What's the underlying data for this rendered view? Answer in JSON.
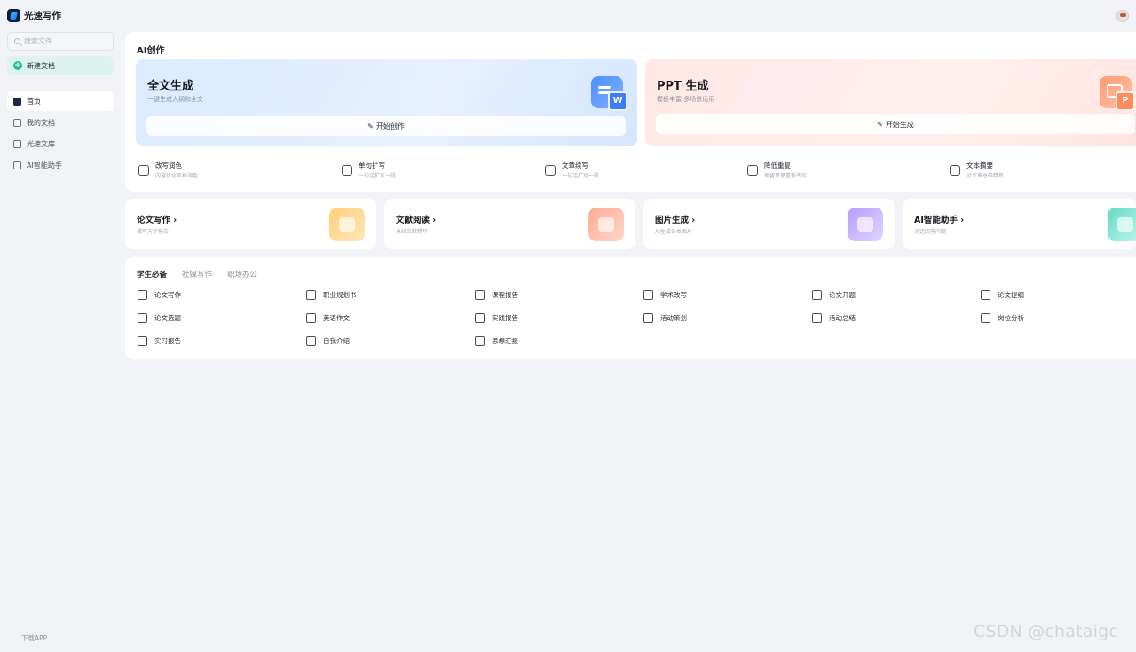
{
  "app": {
    "name": "光速写作"
  },
  "sidebar": {
    "search_placeholder": "搜索文件",
    "new_doc": "新建文档",
    "items": [
      {
        "label": "首页",
        "active": true,
        "icon": "home-icon"
      },
      {
        "label": "我的文档",
        "active": false,
        "icon": "document-icon"
      },
      {
        "label": "光速文库",
        "active": false,
        "icon": "library-icon"
      },
      {
        "label": "AI智能助手",
        "active": false,
        "icon": "chat-icon"
      }
    ],
    "download": "下载APP"
  },
  "ai_section": {
    "title": "AI创作",
    "full_text": {
      "title": "全文生成",
      "subtitle": "一键生成大纲和全文",
      "button": "开始创作"
    },
    "ppt": {
      "title": "PPT 生成",
      "subtitle": "模板丰富 多场景适用",
      "button": "开始生成"
    },
    "tools": [
      {
        "name": "改写润色",
        "desc": "内容优化风格调色",
        "icon": "rewrite-icon"
      },
      {
        "name": "单句扩写",
        "desc": "一句话扩写一段",
        "icon": "expand-icon"
      },
      {
        "name": "文章续写",
        "desc": "一句话扩写一段",
        "icon": "continue-icon"
      },
      {
        "name": "降低重复",
        "desc": "保留意思重新改写",
        "icon": "dedupe-icon"
      },
      {
        "name": "文本摘要",
        "desc": "对文章总结精炼",
        "icon": "summary-icon"
      }
    ]
  },
  "cards": [
    {
      "title": "论文写作 ›",
      "subtitle": "撰写万字报告",
      "color": "#ffd89a"
    },
    {
      "title": "文献阅读 ›",
      "subtitle": "总结文献精华",
      "color": "#ffb9a3"
    },
    {
      "title": "图片生成 ›",
      "subtitle": "AI生成各类图片",
      "color": "#c7b0ff"
    },
    {
      "title": "AI智能助手 ›",
      "subtitle": "对话回答问题",
      "color": "#8ee9d8"
    }
  ],
  "student": {
    "tabs": [
      {
        "label": "学生必备",
        "active": true
      },
      {
        "label": "社媒写作",
        "active": false
      },
      {
        "label": "职场办公",
        "active": false
      }
    ],
    "items": [
      {
        "label": "论文写作",
        "icon": "paper-icon"
      },
      {
        "label": "职业规划书",
        "icon": "plan-icon"
      },
      {
        "label": "课程报告",
        "icon": "course-icon"
      },
      {
        "label": "学术改写",
        "icon": "academic-icon"
      },
      {
        "label": "论文开题",
        "icon": "proposal-icon"
      },
      {
        "label": "论文提纲",
        "icon": "outline-icon"
      },
      {
        "label": "论文选题",
        "icon": "topic-icon"
      },
      {
        "label": "英语作文",
        "icon": "english-icon"
      },
      {
        "label": "实践报告",
        "icon": "practice-icon"
      },
      {
        "label": "活动策划",
        "icon": "event-icon"
      },
      {
        "label": "活动总结",
        "icon": "summary-icon"
      },
      {
        "label": "岗位分析",
        "icon": "analysis-icon"
      },
      {
        "label": "实习报告",
        "icon": "intern-icon"
      },
      {
        "label": "自我介绍",
        "icon": "intro-icon"
      },
      {
        "label": "思想汇报",
        "icon": "report-icon"
      }
    ]
  },
  "watermark": "CSDN @chataigc"
}
